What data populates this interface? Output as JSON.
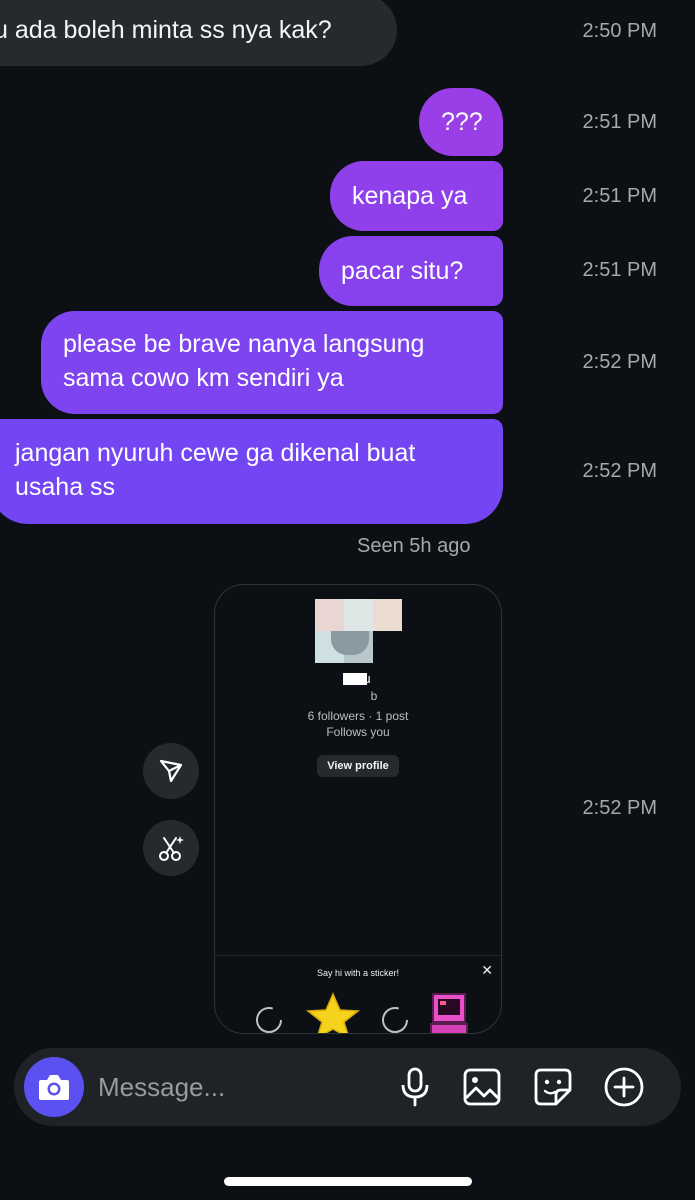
{
  "messages": [
    {
      "side": "in",
      "text": "u ada boleh minta ss nya kak?",
      "time": "2:50 PM"
    },
    {
      "side": "out",
      "text": "???",
      "time": "2:51 PM"
    },
    {
      "side": "out",
      "text": "kenapa ya",
      "time": "2:51 PM"
    },
    {
      "side": "out",
      "text": "pacar situ?",
      "time": "2:51 PM"
    },
    {
      "side": "out",
      "lines": [
        "please be brave nanya langsung",
        "sama cowo km sendiri ya"
      ],
      "time": "2:52 PM"
    },
    {
      "side": "out",
      "lines": [
        "jangan nyuruh cewe ga dikenal buat",
        "usaha ss"
      ],
      "time": "2:52 PM"
    }
  ],
  "seen_label": "Seen 5h ago",
  "shared_profile": {
    "username_fragment": "u",
    "handle_fragment": "b",
    "stats": "6 followers · 1 post",
    "follows_you": "Follows you",
    "view_profile_label": "View profile",
    "sticker_prompt": "Say hi with a sticker!",
    "close_glyph": "✕",
    "time": "2:52 PM"
  },
  "side_actions": [
    "send-icon",
    "cut-icon"
  ],
  "composer": {
    "placeholder": "Message...",
    "icons": [
      "camera-icon",
      "microphone-icon",
      "gallery-icon",
      "sticker-icon",
      "plus-icon"
    ]
  },
  "colors": {
    "background": "#0c1014",
    "incoming_bubble": "#262a2f",
    "outgoing_top": "#9b3de8",
    "outgoing_bottom": "#6b47f5",
    "camera_button": "#5b51f0",
    "timestamp": "#a8a8a8"
  }
}
